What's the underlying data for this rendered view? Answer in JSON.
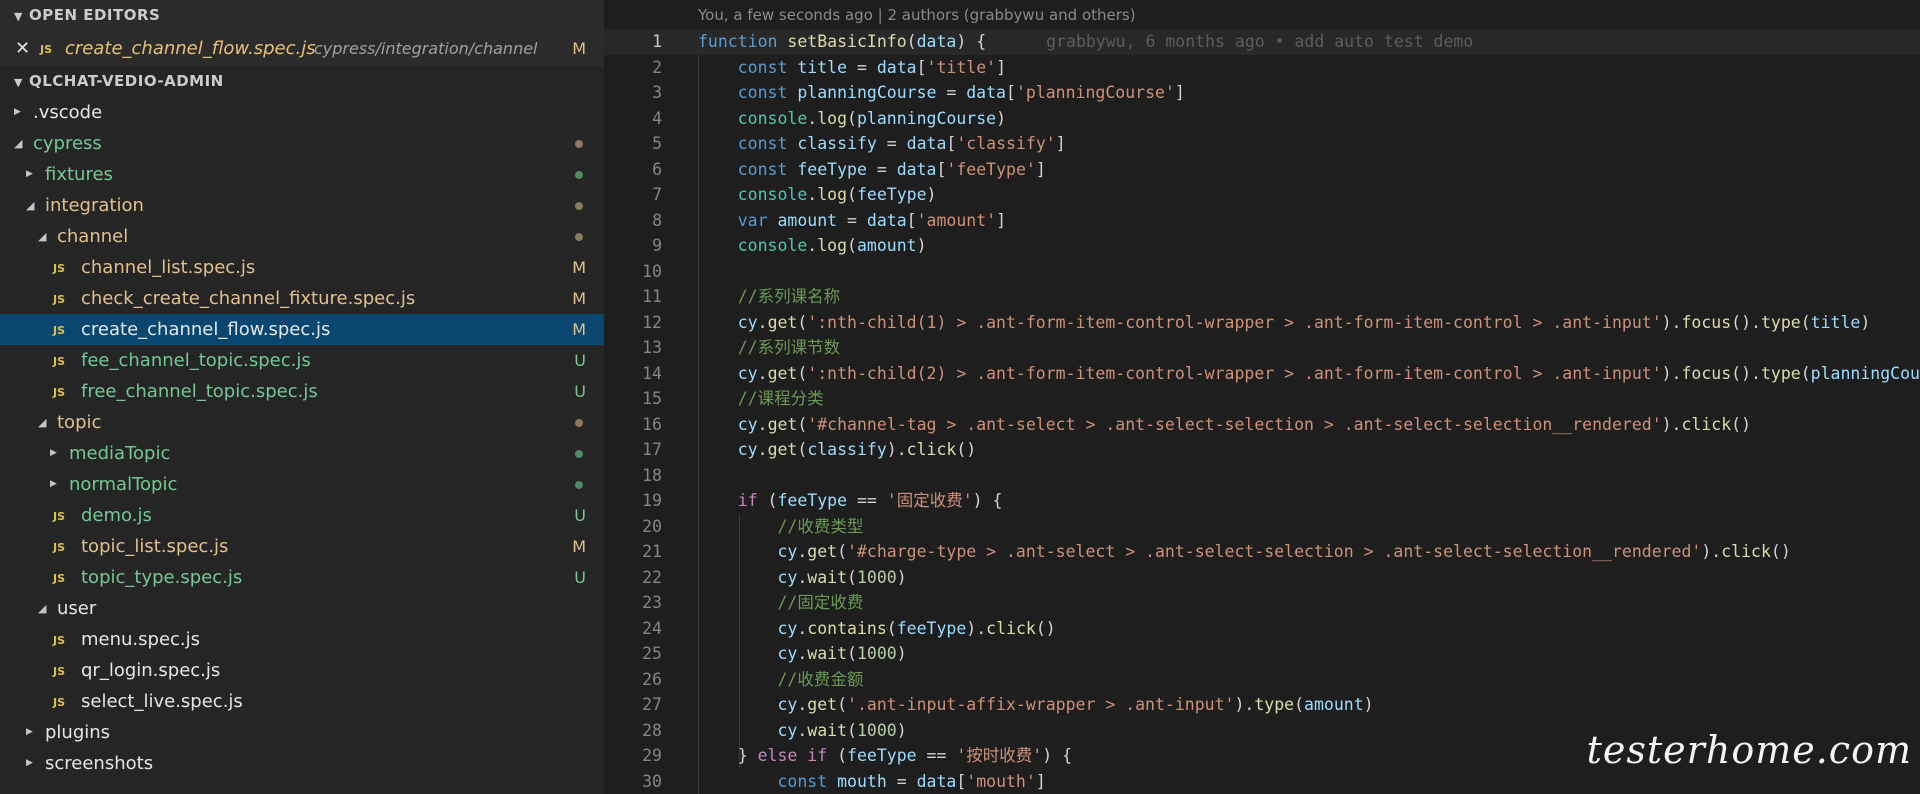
{
  "sidebar": {
    "open_editors_title": "OPEN EDITORS",
    "open_editors": [
      {
        "name": "create_channel_flow.spec.js",
        "path": "cypress/integration/channel",
        "status": "M",
        "badge": "JS"
      }
    ],
    "project_title": "QLCHAT-VEDIO-ADMIN",
    "tree": [
      {
        "label": "vscode",
        "prefix": ".",
        "depth": 0,
        "type": "folder",
        "expanded": false,
        "color": "white",
        "status": ""
      },
      {
        "label": "cypress",
        "depth": 0,
        "type": "folder",
        "expanded": true,
        "color": "green",
        "status": "dot-gray"
      },
      {
        "label": "fixtures",
        "depth": 1,
        "type": "folder",
        "expanded": false,
        "color": "green",
        "status": "dot-green"
      },
      {
        "label": "integration",
        "depth": 1,
        "type": "folder",
        "expanded": true,
        "color": "yellow",
        "status": "dot-gray"
      },
      {
        "label": "channel",
        "depth": 2,
        "type": "folder",
        "expanded": true,
        "color": "yellow",
        "status": "dot-gray"
      },
      {
        "label": "channel_list.spec.js",
        "depth": 2,
        "type": "file",
        "color": "yellow",
        "status": "M"
      },
      {
        "label": "check_create_channel_fixture.spec.js",
        "depth": 2,
        "type": "file",
        "color": "yellow",
        "status": "M"
      },
      {
        "label": "create_channel_flow.spec.js",
        "depth": 2,
        "type": "file",
        "color": "white",
        "status": "M",
        "selected": true
      },
      {
        "label": "fee_channel_topic.spec.js",
        "depth": 2,
        "type": "file",
        "color": "green",
        "status": "U"
      },
      {
        "label": "free_channel_topic.spec.js",
        "depth": 2,
        "type": "file",
        "color": "green",
        "status": "U"
      },
      {
        "label": "topic",
        "depth": 2,
        "type": "folder",
        "expanded": true,
        "color": "yellow",
        "status": "dot-gray"
      },
      {
        "label": "mediaTopic",
        "depth": 3,
        "type": "folder",
        "expanded": false,
        "color": "green",
        "status": "dot-green"
      },
      {
        "label": "normalTopic",
        "depth": 3,
        "type": "folder",
        "expanded": false,
        "color": "green",
        "status": "dot-green"
      },
      {
        "label": "demo.js",
        "depth": 2,
        "type": "file",
        "color": "green",
        "status": "U"
      },
      {
        "label": "topic_list.spec.js",
        "depth": 2,
        "type": "file",
        "color": "yellow",
        "status": "M"
      },
      {
        "label": "topic_type.spec.js",
        "depth": 2,
        "type": "file",
        "color": "green",
        "status": "U"
      },
      {
        "label": "user",
        "depth": 2,
        "type": "folder",
        "expanded": true,
        "color": "white",
        "status": ""
      },
      {
        "label": "menu.spec.js",
        "depth": 2,
        "type": "file",
        "color": "white",
        "status": ""
      },
      {
        "label": "qr_login.spec.js",
        "depth": 2,
        "type": "file",
        "color": "white",
        "status": ""
      },
      {
        "label": "select_live.spec.js",
        "depth": 2,
        "type": "file",
        "color": "white",
        "status": ""
      },
      {
        "label": "plugins",
        "depth": 1,
        "type": "folder",
        "expanded": false,
        "color": "white",
        "status": ""
      },
      {
        "label": "screenshots",
        "depth": 1,
        "type": "folder",
        "expanded": false,
        "color": "white",
        "status": ""
      }
    ]
  },
  "editor": {
    "codelens": "You, a few seconds ago | 2 authors (grabbywu and others)",
    "blame": "grabbywu, 6 months ago • add auto test demo",
    "current_line": 1,
    "lines": [
      [
        [
          "kw",
          "function"
        ],
        [
          "p",
          " "
        ],
        [
          "fn",
          "setBasicInfo"
        ],
        [
          "p",
          "("
        ],
        [
          "var",
          "data"
        ],
        [
          "p",
          ") {"
        ]
      ],
      [
        [
          "i",
          "    "
        ],
        [
          "kw",
          "const"
        ],
        [
          "p",
          " "
        ],
        [
          "var",
          "title"
        ],
        [
          "p",
          " = "
        ],
        [
          "var",
          "data"
        ],
        [
          "p",
          "["
        ],
        [
          "str",
          "'title'"
        ],
        [
          "p",
          "]"
        ]
      ],
      [
        [
          "i",
          "    "
        ],
        [
          "kw",
          "const"
        ],
        [
          "p",
          " "
        ],
        [
          "var",
          "planningCourse"
        ],
        [
          "p",
          " = "
        ],
        [
          "var",
          "data"
        ],
        [
          "p",
          "["
        ],
        [
          "str",
          "'planningCourse'"
        ],
        [
          "p",
          "]"
        ]
      ],
      [
        [
          "i",
          "    "
        ],
        [
          "type",
          "console"
        ],
        [
          "p",
          "."
        ],
        [
          "fn",
          "log"
        ],
        [
          "p",
          "("
        ],
        [
          "var",
          "planningCourse"
        ],
        [
          "p",
          ")"
        ]
      ],
      [
        [
          "i",
          "    "
        ],
        [
          "kw",
          "const"
        ],
        [
          "p",
          " "
        ],
        [
          "var",
          "classify"
        ],
        [
          "p",
          " = "
        ],
        [
          "var",
          "data"
        ],
        [
          "p",
          "["
        ],
        [
          "str",
          "'classify'"
        ],
        [
          "p",
          "]"
        ]
      ],
      [
        [
          "i",
          "    "
        ],
        [
          "kw",
          "const"
        ],
        [
          "p",
          " "
        ],
        [
          "var",
          "feeType"
        ],
        [
          "p",
          " = "
        ],
        [
          "var",
          "data"
        ],
        [
          "p",
          "["
        ],
        [
          "str",
          "'feeType'"
        ],
        [
          "p",
          "]"
        ]
      ],
      [
        [
          "i",
          "    "
        ],
        [
          "type",
          "console"
        ],
        [
          "p",
          "."
        ],
        [
          "fn",
          "log"
        ],
        [
          "p",
          "("
        ],
        [
          "var",
          "feeType"
        ],
        [
          "p",
          ")"
        ]
      ],
      [
        [
          "i",
          "    "
        ],
        [
          "kw",
          "var"
        ],
        [
          "p",
          " "
        ],
        [
          "var",
          "amount"
        ],
        [
          "p",
          " = "
        ],
        [
          "var",
          "data"
        ],
        [
          "p",
          "["
        ],
        [
          "str",
          "'amount'"
        ],
        [
          "p",
          "]"
        ]
      ],
      [
        [
          "i",
          "    "
        ],
        [
          "type",
          "console"
        ],
        [
          "p",
          "."
        ],
        [
          "fn",
          "log"
        ],
        [
          "p",
          "("
        ],
        [
          "var",
          "amount"
        ],
        [
          "p",
          ")"
        ]
      ],
      [],
      [
        [
          "i",
          "    "
        ],
        [
          "cmt",
          "//系列课名称"
        ]
      ],
      [
        [
          "i",
          "    "
        ],
        [
          "var",
          "cy"
        ],
        [
          "p",
          "."
        ],
        [
          "fn",
          "get"
        ],
        [
          "p",
          "("
        ],
        [
          "str",
          "':nth-child(1) > .ant-form-item-control-wrapper > .ant-form-item-control > .ant-input'"
        ],
        [
          "p",
          ")."
        ],
        [
          "fn",
          "focus"
        ],
        [
          "p",
          "()."
        ],
        [
          "fn",
          "type"
        ],
        [
          "p",
          "("
        ],
        [
          "var",
          "title"
        ],
        [
          "p",
          ")"
        ]
      ],
      [
        [
          "i",
          "    "
        ],
        [
          "cmt",
          "//系列课节数"
        ]
      ],
      [
        [
          "i",
          "    "
        ],
        [
          "var",
          "cy"
        ],
        [
          "p",
          "."
        ],
        [
          "fn",
          "get"
        ],
        [
          "p",
          "("
        ],
        [
          "str",
          "':nth-child(2) > .ant-form-item-control-wrapper > .ant-form-item-control > .ant-input'"
        ],
        [
          "p",
          ")."
        ],
        [
          "fn",
          "focus"
        ],
        [
          "p",
          "()."
        ],
        [
          "fn",
          "type"
        ],
        [
          "p",
          "("
        ],
        [
          "var",
          "planningCourse"
        ],
        [
          "p",
          ")"
        ]
      ],
      [
        [
          "i",
          "    "
        ],
        [
          "cmt",
          "//课程分类"
        ]
      ],
      [
        [
          "i",
          "    "
        ],
        [
          "var",
          "cy"
        ],
        [
          "p",
          "."
        ],
        [
          "fn",
          "get"
        ],
        [
          "p",
          "("
        ],
        [
          "str",
          "'#channel-tag > .ant-select > .ant-select-selection > .ant-select-selection__rendered'"
        ],
        [
          "p",
          ")."
        ],
        [
          "fn",
          "click"
        ],
        [
          "p",
          "()"
        ]
      ],
      [
        [
          "i",
          "    "
        ],
        [
          "var",
          "cy"
        ],
        [
          "p",
          "."
        ],
        [
          "fn",
          "get"
        ],
        [
          "p",
          "("
        ],
        [
          "var",
          "classify"
        ],
        [
          "p",
          ")."
        ],
        [
          "fn",
          "click"
        ],
        [
          "p",
          "()"
        ]
      ],
      [],
      [
        [
          "i",
          "    "
        ],
        [
          "kw2",
          "if"
        ],
        [
          "p",
          " ("
        ],
        [
          "var",
          "feeType"
        ],
        [
          "p",
          " == "
        ],
        [
          "str",
          "'固定收费'"
        ],
        [
          "p",
          ") {"
        ]
      ],
      [
        [
          "i",
          "        "
        ],
        [
          "cmt",
          "//收费类型"
        ]
      ],
      [
        [
          "i",
          "        "
        ],
        [
          "var",
          "cy"
        ],
        [
          "p",
          "."
        ],
        [
          "fn",
          "get"
        ],
        [
          "p",
          "("
        ],
        [
          "str",
          "'#charge-type > .ant-select > .ant-select-selection > .ant-select-selection__rendered'"
        ],
        [
          "p",
          ")."
        ],
        [
          "fn",
          "click"
        ],
        [
          "p",
          "()"
        ]
      ],
      [
        [
          "i",
          "        "
        ],
        [
          "var",
          "cy"
        ],
        [
          "p",
          "."
        ],
        [
          "fn",
          "wait"
        ],
        [
          "p",
          "("
        ],
        [
          "num",
          "1000"
        ],
        [
          "p",
          ")"
        ]
      ],
      [
        [
          "i",
          "        "
        ],
        [
          "cmt",
          "//固定收费"
        ]
      ],
      [
        [
          "i",
          "        "
        ],
        [
          "var",
          "cy"
        ],
        [
          "p",
          "."
        ],
        [
          "fn",
          "contains"
        ],
        [
          "p",
          "("
        ],
        [
          "var",
          "feeType"
        ],
        [
          "p",
          ")."
        ],
        [
          "fn",
          "click"
        ],
        [
          "p",
          "()"
        ]
      ],
      [
        [
          "i",
          "        "
        ],
        [
          "var",
          "cy"
        ],
        [
          "p",
          "."
        ],
        [
          "fn",
          "wait"
        ],
        [
          "p",
          "("
        ],
        [
          "num",
          "1000"
        ],
        [
          "p",
          ")"
        ]
      ],
      [
        [
          "i",
          "        "
        ],
        [
          "cmt",
          "//收费金额"
        ]
      ],
      [
        [
          "i",
          "        "
        ],
        [
          "var",
          "cy"
        ],
        [
          "p",
          "."
        ],
        [
          "fn",
          "get"
        ],
        [
          "p",
          "("
        ],
        [
          "str",
          "'.ant-input-affix-wrapper > .ant-input'"
        ],
        [
          "p",
          ")."
        ],
        [
          "fn",
          "type"
        ],
        [
          "p",
          "("
        ],
        [
          "var",
          "amount"
        ],
        [
          "p",
          ")"
        ]
      ],
      [
        [
          "i",
          "        "
        ],
        [
          "var",
          "cy"
        ],
        [
          "p",
          "."
        ],
        [
          "fn",
          "wait"
        ],
        [
          "p",
          "("
        ],
        [
          "num",
          "1000"
        ],
        [
          "p",
          ")"
        ]
      ],
      [
        [
          "i",
          "    "
        ],
        [
          "p",
          "} "
        ],
        [
          "kw2",
          "else if"
        ],
        [
          "p",
          " ("
        ],
        [
          "var",
          "feeType"
        ],
        [
          "p",
          " == "
        ],
        [
          "str",
          "'按时收费'"
        ],
        [
          "p",
          ") {"
        ]
      ],
      [
        [
          "i",
          "        "
        ],
        [
          "kw",
          "const"
        ],
        [
          "p",
          " "
        ],
        [
          "var",
          "mouth"
        ],
        [
          "p",
          " = "
        ],
        [
          "var",
          "data"
        ],
        [
          "p",
          "["
        ],
        [
          "str",
          "'mouth'"
        ],
        [
          "p",
          "]"
        ]
      ]
    ]
  },
  "watermark": "testerhome.com"
}
